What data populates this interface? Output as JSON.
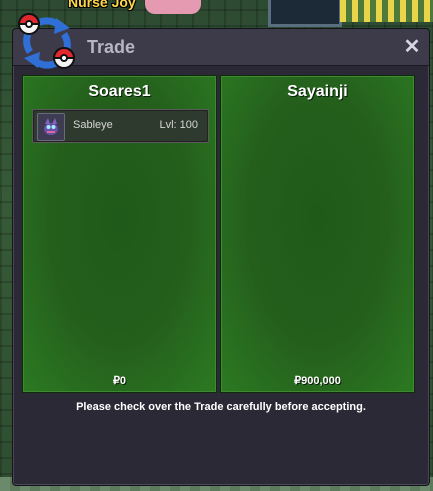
{
  "background": {
    "npc_label": "Nurse Joy"
  },
  "window": {
    "title": "Trade",
    "close_label": "✕"
  },
  "players": [
    {
      "name": "Soares1",
      "items": [
        {
          "name": "Sableye",
          "level": "Lvl: 100",
          "icon": "sableye-icon"
        }
      ],
      "money": "₽0"
    },
    {
      "name": "Sayainji",
      "items": [],
      "money": "₽900,000"
    }
  ],
  "notice": "Please check over the Trade carefully before accepting.",
  "colors": {
    "panel_green": "#245f1c",
    "window_bg": "#2b2936",
    "title_text": "#b7b5c4"
  }
}
